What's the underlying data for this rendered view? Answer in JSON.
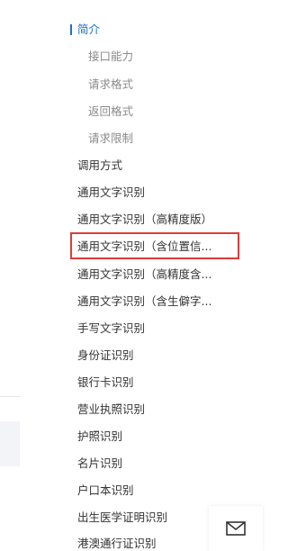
{
  "nav": {
    "items": [
      {
        "label": "简介",
        "state": "active"
      },
      {
        "label": "接口能力",
        "state": "sub"
      },
      {
        "label": "请求格式",
        "state": "sub"
      },
      {
        "label": "返回格式",
        "state": "sub"
      },
      {
        "label": "请求限制",
        "state": "sub"
      },
      {
        "label": "调用方式",
        "state": "normal"
      },
      {
        "label": "通用文字识别",
        "state": "normal"
      },
      {
        "label": "通用文字识别（高精度版）",
        "state": "normal"
      },
      {
        "label": "通用文字识别（含位置信...",
        "state": "highlighted"
      },
      {
        "label": "通用文字识别（高精度含...",
        "state": "normal"
      },
      {
        "label": "通用文字识别（含生僻字...",
        "state": "normal"
      },
      {
        "label": "手写文字识别",
        "state": "normal"
      },
      {
        "label": "身份证识别",
        "state": "normal"
      },
      {
        "label": "银行卡识别",
        "state": "normal"
      },
      {
        "label": "营业执照识别",
        "state": "normal"
      },
      {
        "label": "护照识别",
        "state": "normal"
      },
      {
        "label": "名片识别",
        "state": "normal"
      },
      {
        "label": "户口本识别",
        "state": "normal"
      },
      {
        "label": "出生医学证明识别",
        "state": "normal"
      },
      {
        "label": "港澳通行证识别",
        "state": "normal"
      }
    ]
  },
  "colors": {
    "accent": "#1a73c9",
    "highlight_box": "#e03b3b",
    "text": "#333333",
    "subtext": "#8a8a8a"
  },
  "floating": {
    "icon": "mail-icon"
  }
}
